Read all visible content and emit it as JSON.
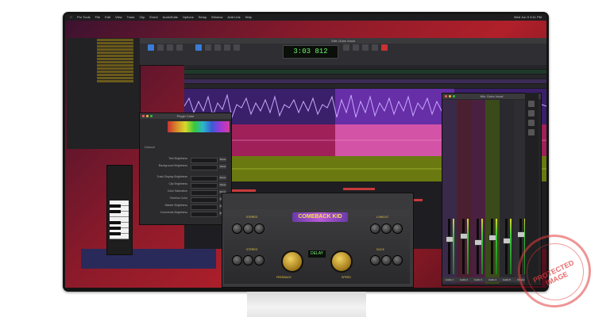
{
  "menubar": {
    "app_name": "Pro Tools",
    "items": [
      "File",
      "Edit",
      "View",
      "Track",
      "Clip",
      "Event",
      "AudioSuite",
      "Options",
      "Setup",
      "Window",
      "Avid Link",
      "Help"
    ],
    "clock": "Wed Jun 9  3:41 PM"
  },
  "edit_window": {
    "title": "Edit: Dubs Vocal",
    "counter": "3:03 812"
  },
  "mixer": {
    "title": "Mix: Dubs Vocal",
    "strips": [
      "Audio 1",
      "Audio 2",
      "Audio 3",
      "Audio 4",
      "Audio 5",
      "Master"
    ]
  },
  "plugin": {
    "title": "COMEBACK KID",
    "display": "DELAY",
    "knob_labels": [
      "STEREO",
      "LOWCUT",
      "STEREO",
      "DUCK",
      "FEEDBACK",
      "SPEED"
    ]
  },
  "inspector": {
    "title": "Plugin Color",
    "section_label": "Default",
    "rows": [
      "Text Brightness",
      "Background Brightness",
      "Track Display Brightness",
      "Clip Brightness",
      "Color Saturation",
      "Timeline Color",
      "Marker Brightness",
      "Comments Brightness"
    ],
    "reset_label": "Reset"
  },
  "watermark": {
    "text": "PROTECTED IMAGE"
  },
  "colors": {
    "wave_purple": "#8a3ad8",
    "clip_pink": "#e0308a",
    "clip_olive": "#8a9a1a",
    "wave_highlight": "#c83ad8",
    "counter_green": "#6cf56c"
  }
}
